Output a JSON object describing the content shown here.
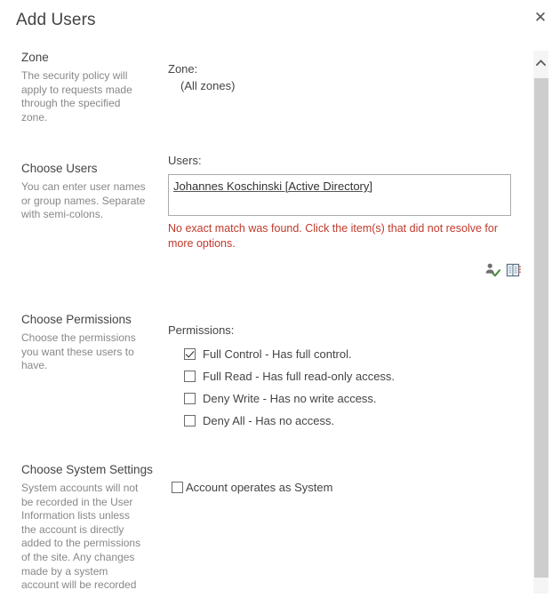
{
  "dialog": {
    "title": "Add Users",
    "close_label": "✕"
  },
  "sections": {
    "zone": {
      "title": "Zone",
      "description": "The security policy will apply to requests made through the specified zone.",
      "field_label": "Zone:",
      "field_value": "(All zones)"
    },
    "choose_users": {
      "title": "Choose Users",
      "description": "You can enter user names or group names. Separate with semi-colons.",
      "field_label": "Users:",
      "entry_value": "Johannes Koschinski [Active Directory]",
      "error_text": "No exact match was found. Click the item(s) that did not resolve for more options.",
      "error_color": "#c0392b",
      "icons": {
        "check_names": "check-names-icon",
        "browse": "address-book-icon"
      }
    },
    "choose_permissions": {
      "title": "Choose Permissions",
      "description": "Choose the permissions you want these users to have.",
      "field_label": "Permissions:",
      "options": [
        {
          "label": "Full Control - Has full control.",
          "checked": true
        },
        {
          "label": "Full Read - Has full read-only access.",
          "checked": false
        },
        {
          "label": "Deny Write - Has no write access.",
          "checked": false
        },
        {
          "label": "Deny All - Has no access.",
          "checked": false
        }
      ]
    },
    "choose_system_settings": {
      "title": "Choose System Settings",
      "description": "System accounts will not be recorded in the User Information lists unless the account is directly added to the permissions of the site.  Any changes made by a system account will be recorded",
      "checkbox_label": "Account operates as System",
      "checkbox_checked": false
    }
  },
  "scrollbar": {
    "up_arrow": "chevron-up-icon"
  }
}
